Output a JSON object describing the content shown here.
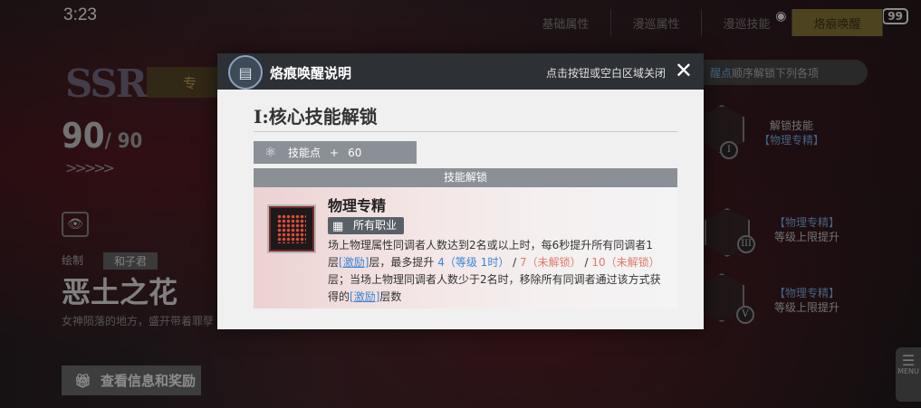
{
  "status_bar": {
    "time": "3:23",
    "battery": "99"
  },
  "top_tabs": [
    "基础属性",
    "漫巡属性",
    "漫巡技能",
    "烙痕唤醒"
  ],
  "character": {
    "rarity": "SSR",
    "badge": "专",
    "level": "90",
    "max_level": "/ 90",
    "arrows": ">>>>>",
    "credit_key": "绘制",
    "credit_value": "和子君",
    "name": "恶土之花",
    "description": "女神陨落的地方，盛开带着罪孽",
    "info_button": "查看信息和奖励"
  },
  "right_panel": {
    "hint_highlight": "醒点",
    "hint_rest": "顺序解锁下列各项",
    "nodes": [
      {
        "num": "I",
        "label1": "解锁技能",
        "label2": "【物理专精】"
      },
      {
        "num": "III",
        "label1": "【物理专精】",
        "label2": "等级上限提升"
      },
      {
        "num": "V",
        "label1": "【物理专精】",
        "label2": "等级上限提升"
      }
    ],
    "menu_label": "MENU"
  },
  "modal": {
    "title": "烙痕唤醒说明",
    "close_hint": "点击按钮或空白区域关闭",
    "section_title": "I:核心技能解锁",
    "skill_points_label": "技能点",
    "skill_points_plus": "+",
    "skill_points_value": "60",
    "unlock_bar": "技能解锁",
    "skill": {
      "name": "物理专精",
      "tag": "所有职业",
      "desc_1": "场上物理属性同调者人数达到2名或以上时，每6秒提升所有同调者1层",
      "link": "[激励]",
      "desc_2": "层，最多提升",
      "level1": "4（等级 1时）",
      "sep": "/",
      "level2": "7（未解锁）",
      "level3": "10（未解锁）",
      "desc_3": "层；当场上物理同调者人数少于2名时，移除所有同调者通过该方式获得的",
      "desc_4": "层数"
    }
  }
}
